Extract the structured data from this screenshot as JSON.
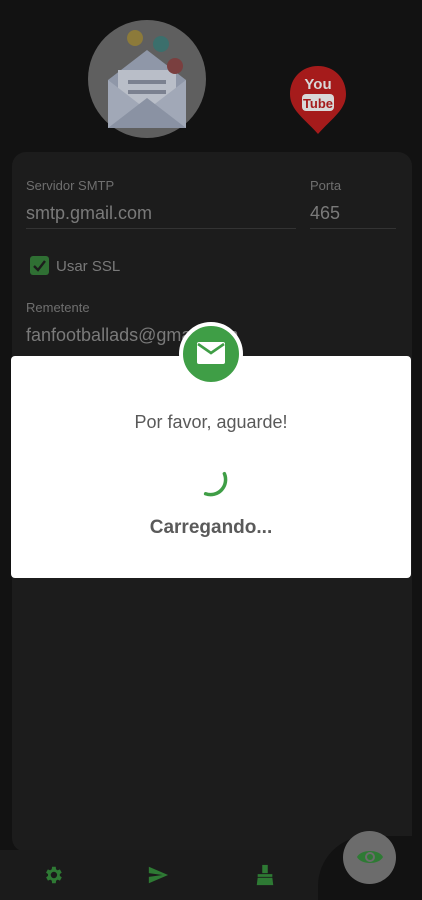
{
  "form": {
    "smtp_server_label": "Servidor SMTP",
    "smtp_server_value": "smtp.gmail.com",
    "port_label": "Porta",
    "port_value": "465",
    "ssl_label": "Usar SSL",
    "ssl_checked": true,
    "sender_label": "Remetente",
    "sender_value": "fanfootballads@gmail.com"
  },
  "logos": {
    "youtube_text_top": "You",
    "youtube_text_bottom": "Tube",
    "youtube_color": "#cc1f1f"
  },
  "dialog": {
    "message": "Por favor, aguarde!",
    "loading_text": "Carregando...",
    "badge_icon": "mail-icon",
    "accent_color": "#3f9e46"
  },
  "bottom_nav": {
    "items": [
      {
        "icon": "gear-icon"
      },
      {
        "icon": "send-icon"
      },
      {
        "icon": "broom-icon"
      }
    ],
    "fab_icon": "eye-icon"
  }
}
